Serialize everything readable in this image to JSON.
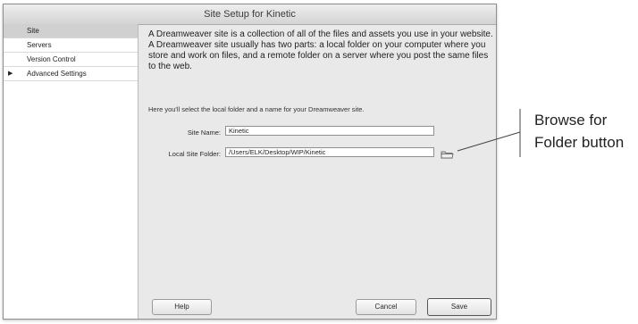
{
  "dialog": {
    "title": "Site Setup for Kinetic"
  },
  "sidebar": {
    "items": [
      {
        "label": "Site",
        "selected": true
      },
      {
        "label": "Servers"
      },
      {
        "label": "Version Control"
      },
      {
        "label": "Advanced Settings",
        "expandable": true
      }
    ]
  },
  "main": {
    "intro": "A Dreamweaver site is a collection of all of the files and assets you use in your website. A Dreamweaver site usually has two parts: a local folder on your computer where you store and work on files, and a remote folder on a server where you post the same files to the web.",
    "hint": "Here you'll select the local folder and a name for your Dreamweaver site.",
    "site_name_label": "Site Name:",
    "site_name_value": "Kinetic",
    "local_folder_label": "Local Site Folder:",
    "local_folder_value": "/Users/ELK/Desktop/WIP/Kinetic",
    "folder_icon": "folder-icon"
  },
  "buttons": {
    "help": "Help",
    "cancel": "Cancel",
    "save": "Save"
  },
  "callout": {
    "text": "Browse for Folder button"
  }
}
